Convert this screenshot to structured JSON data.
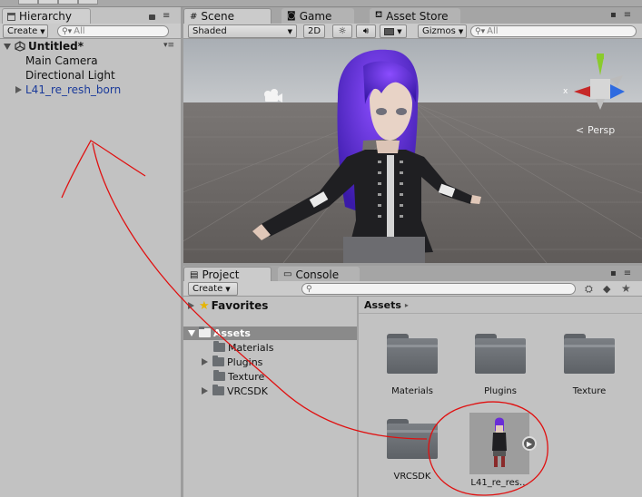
{
  "hierarchy": {
    "tab_label": "Hierarchy",
    "create_label": "Create",
    "search_placeholder": "All",
    "scene_name": "Untitled*",
    "items": [
      {
        "label": "Main Camera"
      },
      {
        "label": "Directional Light"
      },
      {
        "label": "L41_re_resh_born"
      }
    ]
  },
  "scene": {
    "tabs": [
      {
        "label": "Scene"
      },
      {
        "label": "Game"
      },
      {
        "label": "Asset Store"
      }
    ],
    "shading_mode": "Shaded",
    "mode_2d": "2D",
    "gizmos_label": "Gizmos",
    "search_placeholder": "All",
    "persp_label": "Persp"
  },
  "project": {
    "tabs": [
      {
        "label": "Project"
      },
      {
        "label": "Console"
      }
    ],
    "create_label": "Create",
    "favorites_label": "Favorites",
    "assets_label": "Assets",
    "tree_items": [
      {
        "label": "Materials"
      },
      {
        "label": "Plugins"
      },
      {
        "label": "Texture"
      },
      {
        "label": "VRCSDK"
      }
    ],
    "breadcrumb": "Assets",
    "grid_items": [
      {
        "label": "Materials"
      },
      {
        "label": "Plugins"
      },
      {
        "label": "Texture"
      },
      {
        "label": "VRCSDK"
      },
      {
        "label": "L41_re_res..."
      }
    ]
  },
  "colors": {
    "annotation": "#e01010",
    "selection": "#8a8a8a",
    "prefab_text": "#1a3a9a"
  }
}
